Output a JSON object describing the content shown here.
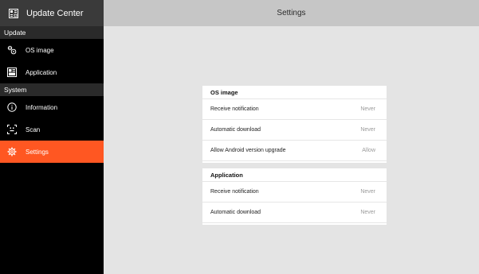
{
  "app": {
    "title": "Update Center"
  },
  "header": {
    "title": "Settings"
  },
  "sidebar": {
    "sections": [
      {
        "label": "Update",
        "items": [
          {
            "label": "OS image",
            "icon": "os-image-icon"
          },
          {
            "label": "Application",
            "icon": "application-icon"
          }
        ]
      },
      {
        "label": "System",
        "items": [
          {
            "label": "Information",
            "icon": "info-icon"
          },
          {
            "label": "Scan",
            "icon": "scan-icon"
          },
          {
            "label": "Settings",
            "icon": "gear-icon",
            "active": true
          }
        ]
      }
    ]
  },
  "settings": {
    "os_image": {
      "title": "OS image",
      "rows": [
        {
          "label": "Receive notification",
          "value": "Never"
        },
        {
          "label": "Automatic download",
          "value": "Never"
        },
        {
          "label": "Allow Android version upgrade",
          "value": "Allow"
        }
      ]
    },
    "application": {
      "title": "Application",
      "rows": [
        {
          "label": "Receive notification",
          "value": "Never"
        },
        {
          "label": "Automatic download",
          "value": "Never"
        }
      ]
    }
  },
  "colors": {
    "accent": "#ff5722",
    "sidebar_bg": "#000000",
    "header_bg": "#c6c6c6",
    "content_bg": "#e4e4e4"
  }
}
